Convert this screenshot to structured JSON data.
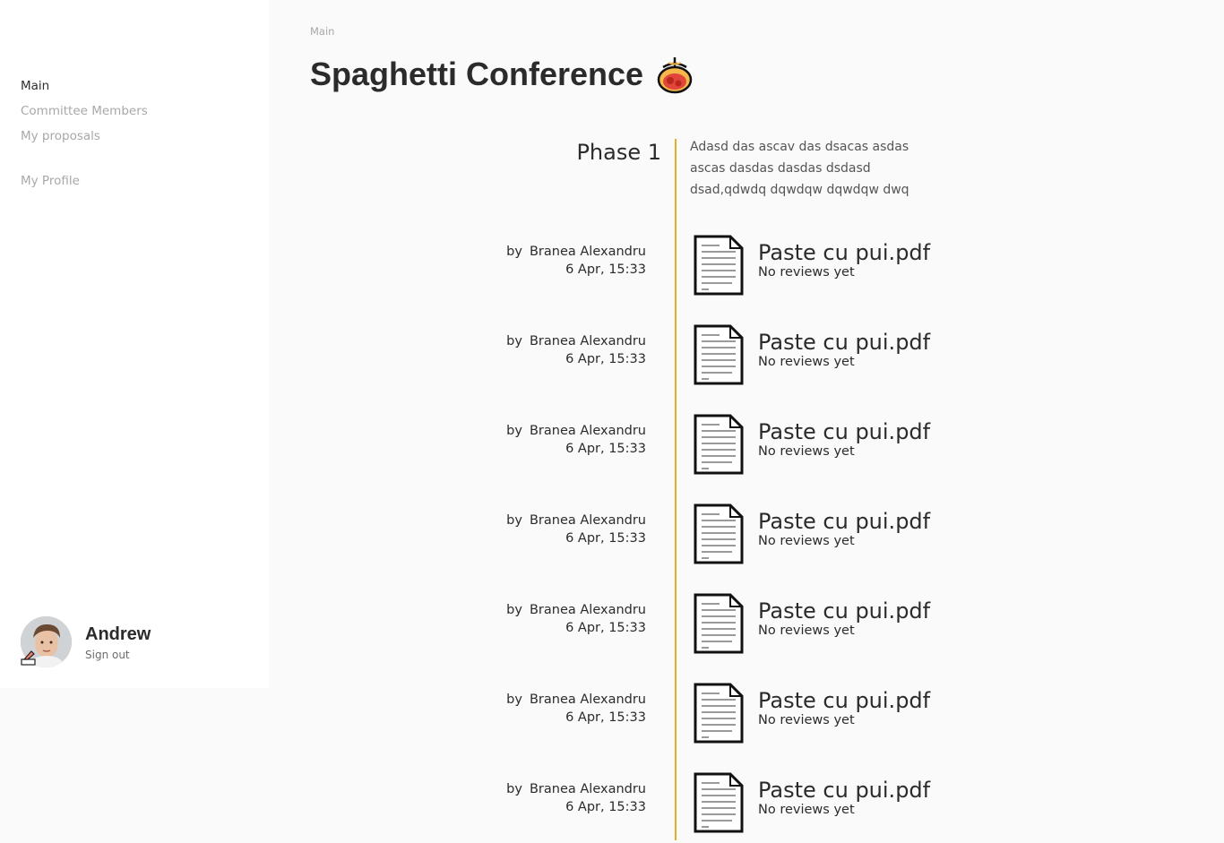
{
  "sidebar": {
    "nav": [
      {
        "label": "Main",
        "active": true
      },
      {
        "label": "Committee Members",
        "active": false
      },
      {
        "label": "My proposals",
        "active": false
      }
    ],
    "profile_link": "My Profile",
    "user": {
      "name": "Andrew",
      "signout": "Sign out",
      "avatar_icon": "user-avatar-photo",
      "badge_icon": "pencil-edit-icon"
    }
  },
  "breadcrumb": "Main",
  "page": {
    "title": "Spaghetti Conference",
    "logo_icon": "spaghetti-bowl-icon"
  },
  "phase": {
    "title": "Phase 1",
    "description": "Adasd das ascav das dsacas asdas ascas dasdas dasdas dsdasd dsad,qdwdq dqwdqw dqwdqw dwq"
  },
  "colors": {
    "timeline_accent": "#e4ad2c",
    "sidebar_bg": "#ffffff",
    "page_bg": "#fafafa",
    "muted_text": "#a8a8a8"
  },
  "proposals": [
    {
      "by": "by",
      "author": "Branea Alexandru",
      "date": "6 Apr, 15:33",
      "file": "Paste cu pui.pdf",
      "reviews": "No reviews yet",
      "icon": "document-icon"
    },
    {
      "by": "by",
      "author": "Branea Alexandru",
      "date": "6 Apr, 15:33",
      "file": "Paste cu pui.pdf",
      "reviews": "No reviews yet",
      "icon": "document-icon"
    },
    {
      "by": "by",
      "author": "Branea Alexandru",
      "date": "6 Apr, 15:33",
      "file": "Paste cu pui.pdf",
      "reviews": "No reviews yet",
      "icon": "document-icon"
    },
    {
      "by": "by",
      "author": "Branea Alexandru",
      "date": "6 Apr, 15:33",
      "file": "Paste cu pui.pdf",
      "reviews": "No reviews yet",
      "icon": "document-icon"
    },
    {
      "by": "by",
      "author": "Branea Alexandru",
      "date": "6 Apr, 15:33",
      "file": "Paste cu pui.pdf",
      "reviews": "No reviews yet",
      "icon": "document-icon"
    },
    {
      "by": "by",
      "author": "Branea Alexandru",
      "date": "6 Apr, 15:33",
      "file": "Paste cu pui.pdf",
      "reviews": "No reviews yet",
      "icon": "document-icon"
    },
    {
      "by": "by",
      "author": "Branea Alexandru",
      "date": "6 Apr, 15:33",
      "file": "Paste cu pui.pdf",
      "reviews": "No reviews yet",
      "icon": "document-icon"
    }
  ]
}
